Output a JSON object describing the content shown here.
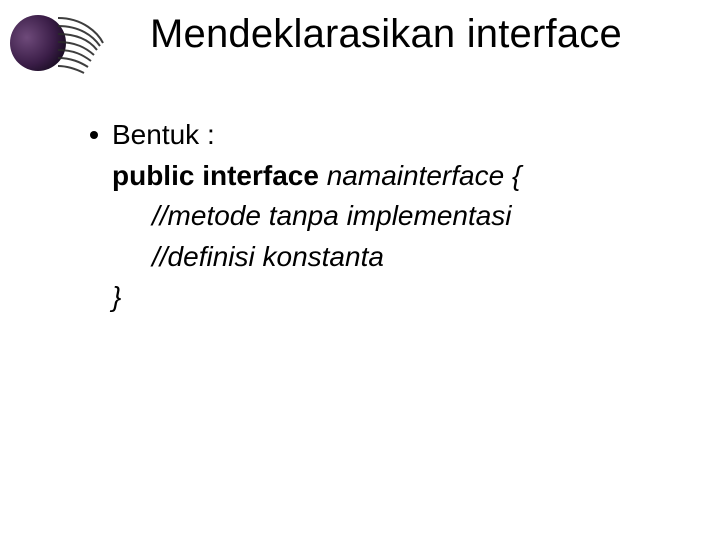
{
  "title": "Mendeklarasikan interface",
  "body": {
    "bullet_label": "Bentuk :",
    "code": {
      "l1": {
        "kw": "public interface",
        "name": "namainterface",
        "brace": "{"
      },
      "l2": "//metode tanpa implementasi",
      "l3": "//definisi konstanta",
      "l4": "}"
    }
  }
}
